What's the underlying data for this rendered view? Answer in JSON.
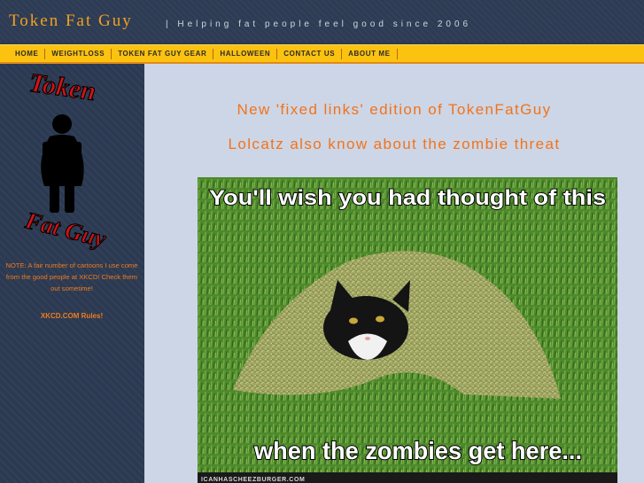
{
  "header": {
    "title": "Token Fat Guy",
    "tagline": "| Helping fat people feel good since 2006"
  },
  "nav": {
    "items": [
      "HOME",
      "WEIGHTLOSS",
      "TOKEN FAT GUY GEAR",
      "HALLOWEEN",
      "CONTACT US",
      "ABOUT ME"
    ]
  },
  "sidebar": {
    "logo_top": "Token",
    "logo_bottom": "Fat Guy",
    "note": "NOTE:  A fair number of cartoons I use come from the good people at XKCD!  Check them out sometime!",
    "link": "XKCD.COM Rules!"
  },
  "main": {
    "headline_1": "New 'fixed links' edition of TokenFatGuy",
    "headline_2": "Lolcatz also know about the zombie threat",
    "image": {
      "caption_top": "You'll wish you had thought of this",
      "caption_bottom": "when the zombies get here...",
      "watermark": "ICANHASCHEEZBURGER.COM"
    }
  },
  "colors": {
    "accent_orange": "#f1731c",
    "nav_yellow": "#fcc210",
    "logo_red": "#cc1010",
    "sidebar_bg": "#2b3a52",
    "content_bg": "#cdd6e6"
  }
}
